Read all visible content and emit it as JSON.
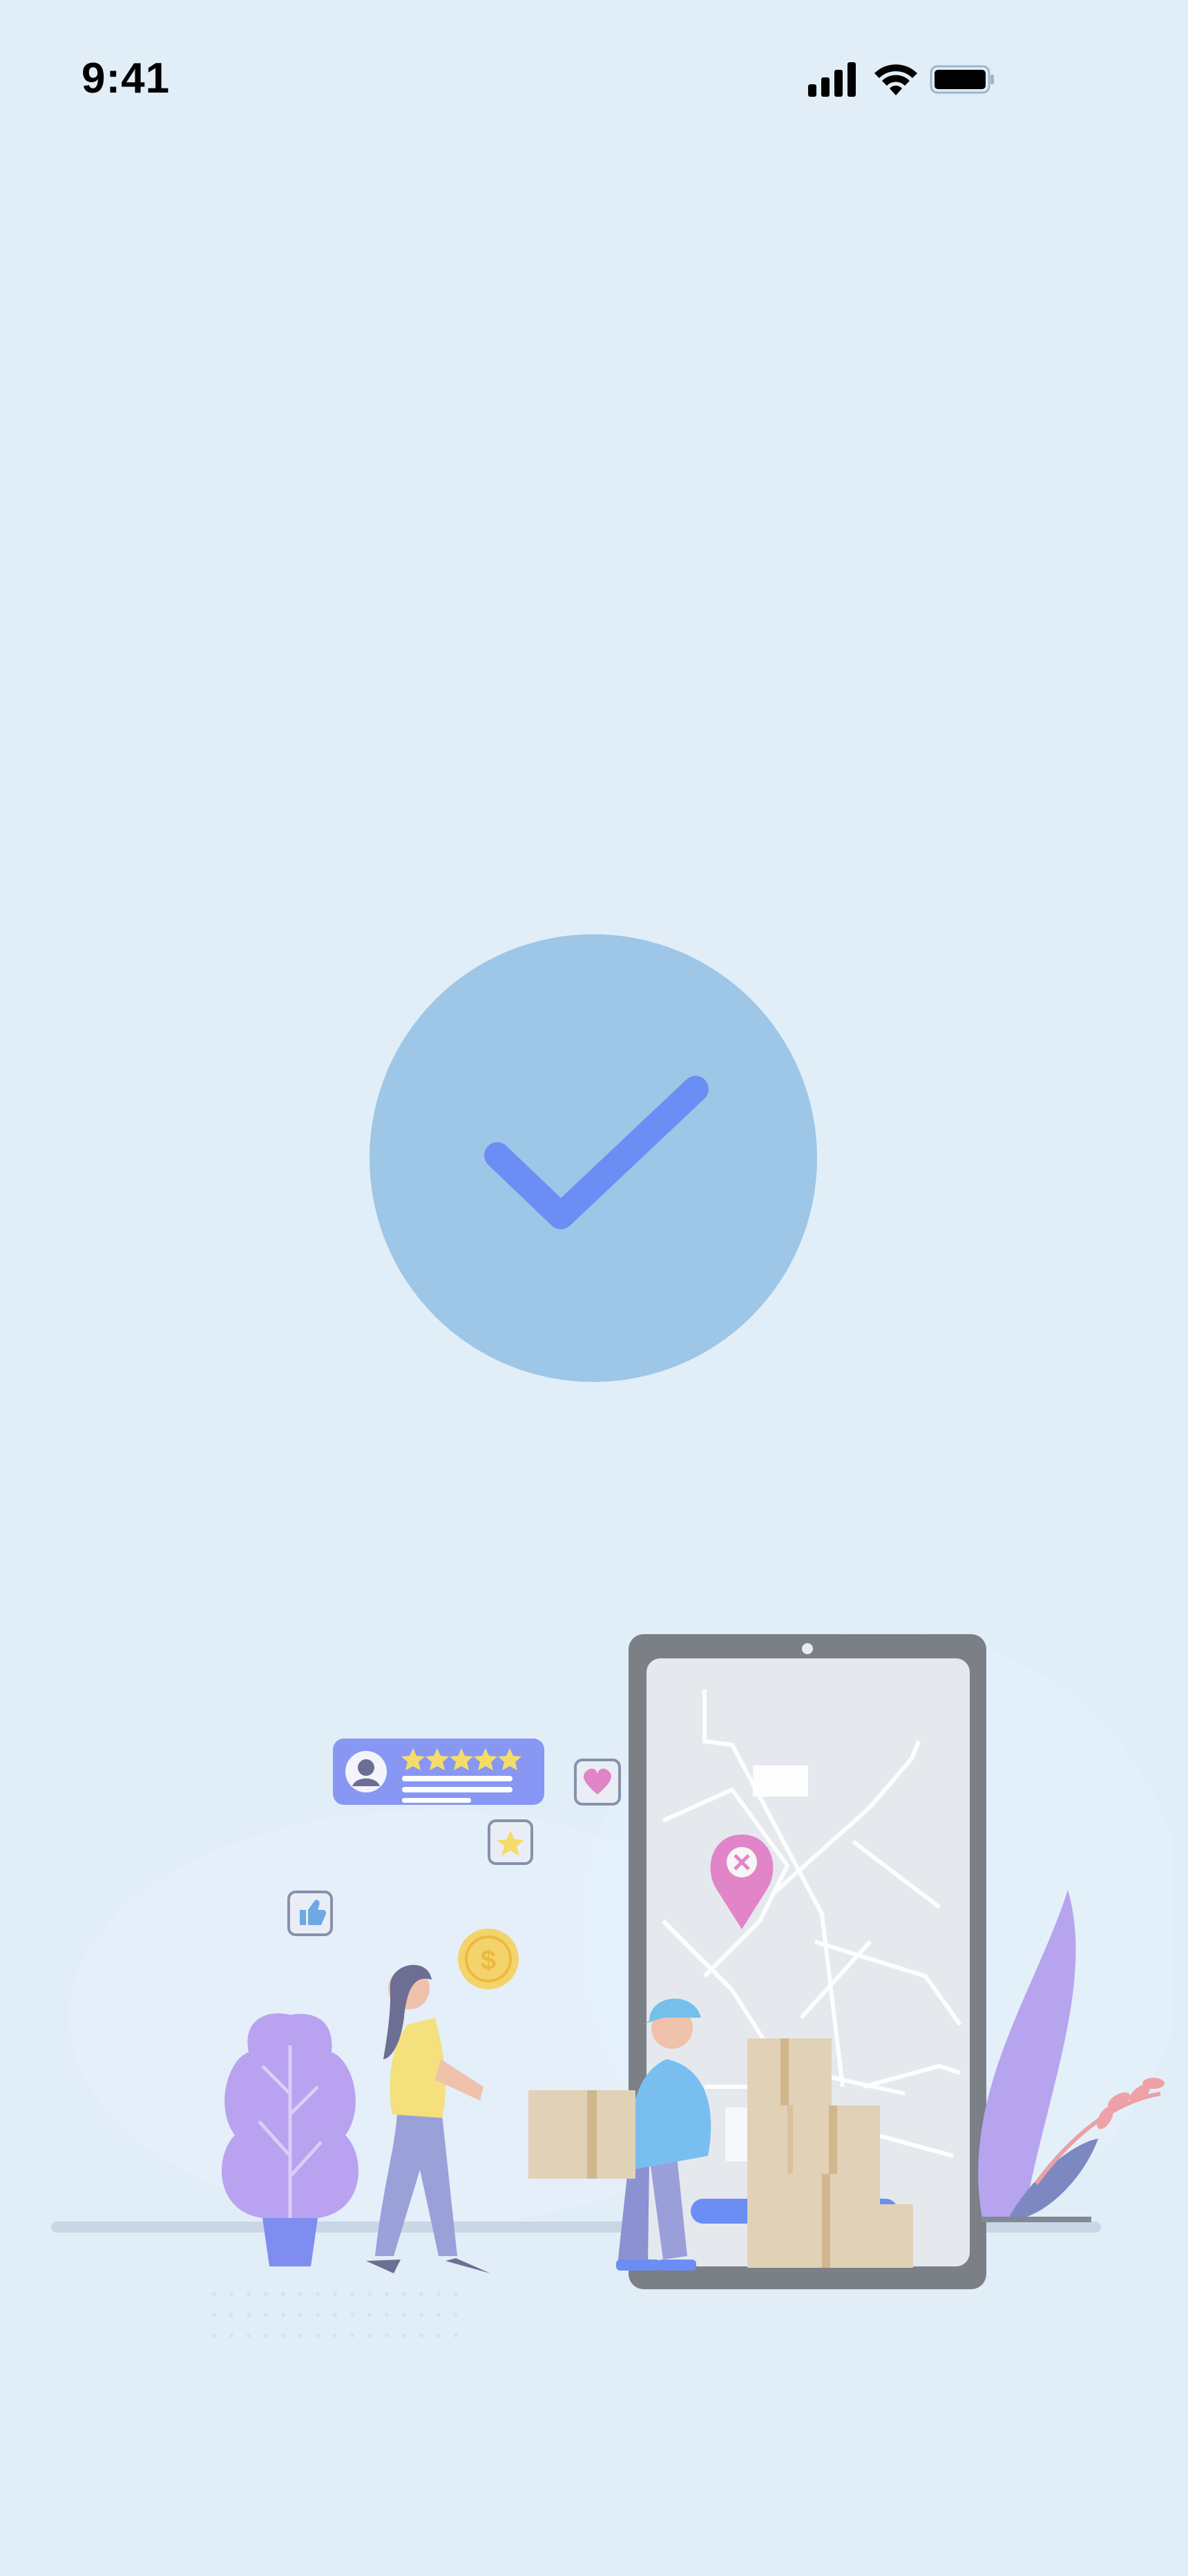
{
  "status_bar": {
    "time": "9:41",
    "icons": [
      "signal-icon",
      "wifi-icon",
      "battery-icon"
    ]
  },
  "success": {
    "icon": "checkmark-icon",
    "colors": {
      "circle": "#9dc6e7",
      "checkmark": "#6b8ef4"
    }
  },
  "illustration": {
    "name": "delivery-illustration",
    "rating_stars": 5
  },
  "colors": {
    "background": "#e1eef7",
    "accent": "#6b8ef4"
  }
}
